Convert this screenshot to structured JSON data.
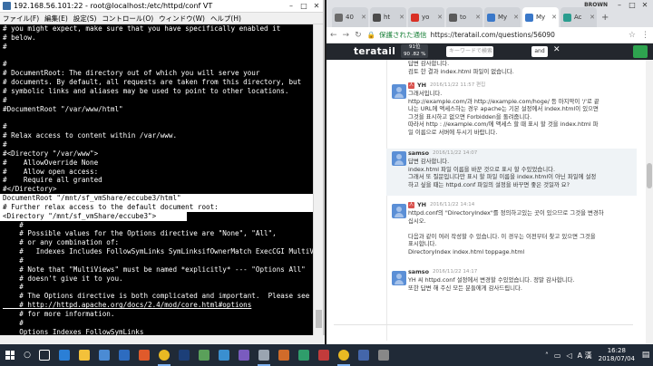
{
  "terminal": {
    "title": "192.168.56.101:22 - root@localhost:/etc/httpd/conf VT",
    "menu": [
      "ファイル(F)",
      "編集(E)",
      "設定(S)",
      "コントロール(O)",
      "ウィンドウ(W)",
      "ヘルプ(H)"
    ],
    "lines": [
      "# you might expect, make sure that you have specifically enabled it",
      "# below.",
      "#",
      "",
      "#",
      "# DocumentRoot: The directory out of which you will serve your",
      "# documents. By default, all requests are taken from this directory, but",
      "# symbolic links and aliases may be used to point to other locations.",
      "#",
      "#DocumentRoot \"/var/www/html\"",
      "",
      "#",
      "# Relax access to content within /var/www.",
      "#",
      "#<Directory \"/var/www\">",
      "#    AllowOverride None",
      "#    Allow open access:",
      "#    Require all granted",
      "#</Directory>",
      "DocumentRoot \"/mnt/sf_vmShare/eccube3/html\"",
      "# Further relax access to the default document root:",
      "<Directory \"/mnt/sf_vmShare/eccube3\">",
      "    #",
      "    # Possible values for the Options directive are \"None\", \"All\",",
      "    # or any combination of:",
      "    #   Indexes Includes FollowSymLinks SymLinksifOwnerMatch ExecCGI MultiViews",
      "    #",
      "    # Note that \"MultiViews\" must be named *explicitly* --- \"Options All\"",
      "    # doesn't give it to you.",
      "    #",
      "    # The Options directive is both complicated and important.  Please see",
      "    # http://httpd.apache.org/docs/2.4/mod/core.html#options",
      "    # for more information.",
      "    #",
      "    Options Indexes FollowSymLinks"
    ]
  },
  "browser": {
    "tabs": [
      {
        "label": "40",
        "color": "#6b6b6b"
      },
      {
        "label": "ht",
        "color": "#4a4a4a"
      },
      {
        "label": "yo",
        "color": "#d93025"
      },
      {
        "label": "to",
        "color": "#5a5a5a"
      },
      {
        "label": "My",
        "color": "#3a78c9"
      },
      {
        "label": "My",
        "color": "#3a78c9"
      },
      {
        "label": "Ac",
        "color": "#2a9d8f"
      }
    ],
    "profile": "BROWN",
    "secure_label": "保護された通信",
    "url": "https://teratail.com/questions/56090",
    "site_logo": "teratail",
    "score_line1": "91位",
    "score_line2": "90 .82 %",
    "search_placeholder": "キーワードで検索",
    "search_and": "and"
  },
  "comments": {
    "top_lines": [
      "답변 감사합니다.",
      "검토 한 결과 index.html 파일이 없습니다."
    ],
    "c1": {
      "user": "YH",
      "date": "2016/11/22 11:57 편집",
      "lines": [
        "그래서입니다.",
        "http://example.com/과 http://example.com/hoge/ 등 마지막이 '/'로 끝",
        "나는 URL에 액세스하는 경우 apache는 기본 설정에서 index.html이 있으면",
        "그것을 표시하고 없으면 Forbidden을 돌려줍니다.",
        "따라서 http : //example.com/에 액세스 할 때 표시 할 것을 index.html 파",
        "일 이름으로 서버에 두시기 바랍니다."
      ]
    },
    "c2": {
      "user": "samso",
      "date": "2016/11/22 14:07",
      "lines": [
        "답변 감사합니다.",
        "index.html 파일 이름을 바꾼 것으로 표시 할 수있었습니다.",
        "그래서 또 질문입니다만 표시 할 파일 이름을 index.html이 아닌 파일에 설정",
        "하고 싶을 때는 httpd.conf 파일의 설정을 바꾸면 좋은 것일까 요?"
      ]
    },
    "c3": {
      "user": "YH",
      "date": "2016/11/22 14:14",
      "lines": [
        "httpd.conf의 \"DirectoryIndex\"를 정의하고있는 곳이 있으므로 그것을 변경하",
        "십시오.",
        "",
        "다음과 같이 여러 작성할 수 있습니다. 이 경우는 이전부터 찾고 있으면 그것을",
        "표시합니다.",
        "DirectoryIndex index.html toppage.html"
      ]
    },
    "c4": {
      "user": "samso",
      "date": "2016/11/22 14:17",
      "lines": [
        "YH 씨 httpd.conf 설정에서 변경할 수있었습니다. 정말 감사합니다.",
        "또한 답변 해 주신 모든 분들에게 감사드립니다."
      ]
    }
  },
  "taskbar": {
    "ime": "A 漢",
    "time": "16:28",
    "date": "2018/07/04"
  }
}
